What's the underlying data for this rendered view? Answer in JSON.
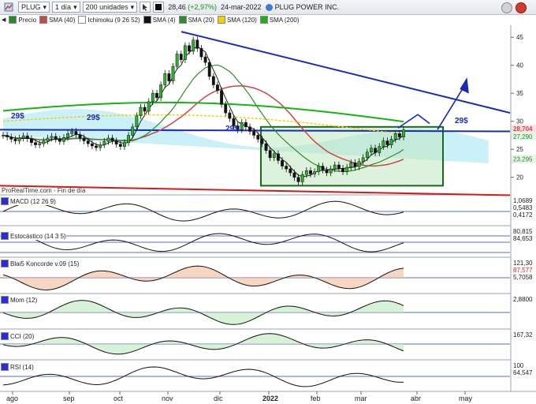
{
  "toolbar": {
    "ticker": "PLUG",
    "period": "1 día",
    "units": "200 unidades",
    "price": "28,46",
    "change": "(+2,97%)",
    "date": "24-mar-2022",
    "company": "PLUG POWER INC."
  },
  "legend": [
    {
      "label": "Precio",
      "color": "#2a8a2a"
    },
    {
      "label": "SMA (40)",
      "color": "#c84848"
    },
    {
      "label": "Ichimoku (9 26 52)",
      "color": "#ffffff"
    },
    {
      "label": "SMA (4)",
      "color": "#111111"
    },
    {
      "label": "SMA (20)",
      "color": "#2e8b2e"
    },
    {
      "label": "SMA (120)",
      "color": "#f0d000"
    },
    {
      "label": "SMA (200)",
      "color": "#16b416"
    }
  ],
  "watermark": "ProRealTime.com - Fin de día",
  "indicators": [
    {
      "name": "MACD (12 26 9)",
      "values": [
        "1,0689",
        "0,5483",
        "0,4172"
      ]
    },
    {
      "name": "Estocástico (14 3 5)",
      "values": [
        "80,815",
        "84,653"
      ]
    },
    {
      "name": "Blai5 Koncorde v.09 (15)",
      "values": [
        "121,30",
        "87,577",
        "5,7058"
      ]
    },
    {
      "name": "Mom (12)",
      "values": [
        "2,8800"
      ]
    },
    {
      "name": "CCI (20)",
      "values": [
        "167,32"
      ]
    },
    {
      "name": "RSI (14)",
      "values": [
        "100",
        "64,547"
      ]
    }
  ],
  "annotations": {
    "support_label": "29$"
  },
  "chart_data": {
    "type": "candlestick",
    "title": "PLUG POWER INC.",
    "x_labels": [
      "ago",
      "sep",
      "oct",
      "nov",
      "dic",
      "2022",
      "feb",
      "mar",
      "abr",
      "may"
    ],
    "y_ticks": [
      45,
      40,
      35,
      30,
      25,
      20
    ],
    "ylim": [
      17,
      47
    ],
    "price_tags": [
      "28,704",
      "27,290",
      "23,295"
    ],
    "support_level": 29,
    "closes": [
      27.5,
      27.2,
      26.8,
      26.5,
      27.0,
      27.4,
      26.9,
      26.2,
      25.8,
      26.0,
      26.5,
      27.0,
      27.3,
      26.8,
      26.4,
      27.1,
      27.8,
      28.2,
      27.6,
      27.0,
      26.5,
      26.0,
      25.6,
      25.3,
      25.8,
      26.4,
      27.0,
      26.5,
      25.9,
      25.5,
      26.2,
      27.5,
      29.0,
      31.0,
      32.5,
      31.8,
      33.5,
      35.0,
      34.2,
      36.5,
      38.5,
      37.2,
      39.8,
      42.0,
      41.0,
      43.5,
      42.5,
      44.5,
      43.0,
      41.5,
      40.5,
      38.0,
      36.5,
      35.5,
      33.0,
      31.5,
      30.5,
      29.2,
      28.5,
      29.8,
      29.0,
      28.2,
      27.5,
      26.8,
      26.0,
      24.8,
      23.5,
      24.2,
      23.0,
      22.0,
      21.5,
      20.8,
      20.0,
      19.2,
      20.5,
      21.2,
      20.6,
      21.0,
      22.0,
      21.3,
      20.8,
      21.5,
      22.2,
      21.6,
      21.0,
      21.8,
      22.6,
      21.9,
      22.8,
      23.5,
      24.5,
      25.2,
      24.4,
      25.5,
      26.5,
      25.8,
      26.8,
      27.8,
      27.2,
      28.46
    ]
  }
}
